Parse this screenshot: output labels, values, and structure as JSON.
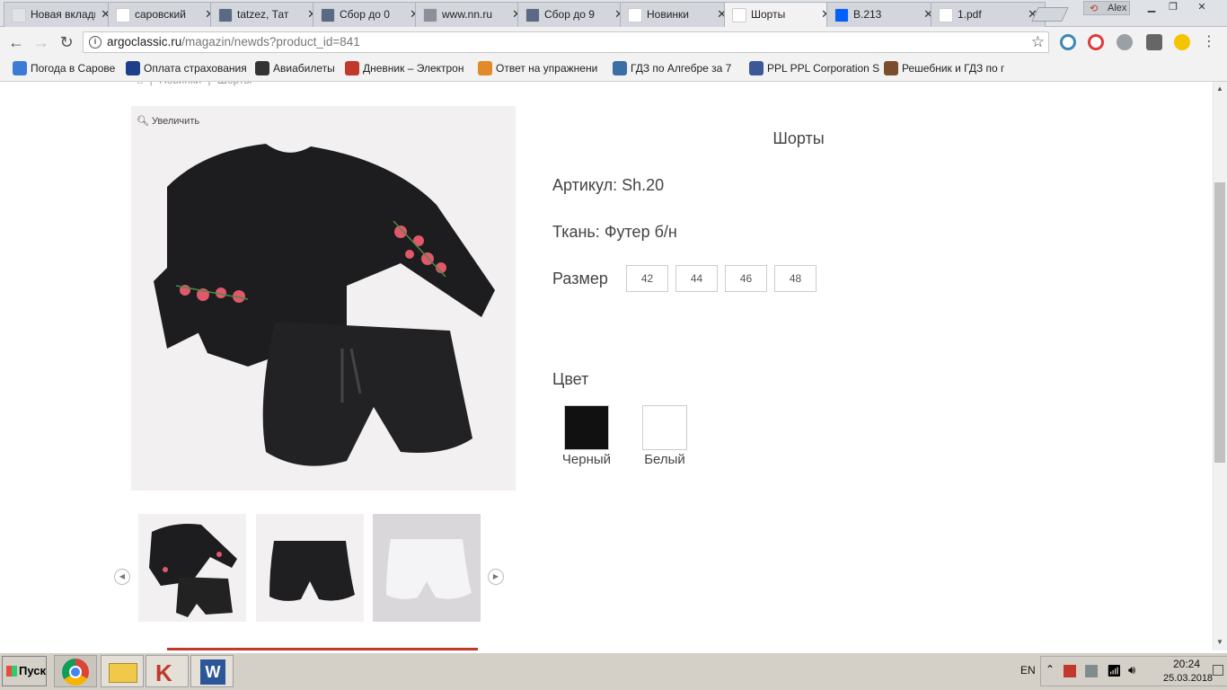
{
  "browser": {
    "tabs": [
      {
        "label": "Новая вкладка",
        "icon": "blank-page-icon",
        "color": "#dfe3e8"
      },
      {
        "label": "саровский",
        "icon": "google-icon",
        "color": "#ffffff"
      },
      {
        "label": "tatzez, Тат",
        "icon": "nn-icon",
        "color": "#5a6a85"
      },
      {
        "label": "Сбор до 0",
        "icon": "nn-icon",
        "color": "#5a6a85"
      },
      {
        "label": "www.nn.ru",
        "icon": "nn-icon",
        "color": "#8a8f99"
      },
      {
        "label": "Сбор до 9",
        "icon": "nn-icon",
        "color": "#5a6a85"
      },
      {
        "label": "Новинки",
        "icon": "gmail-icon",
        "color": "#ffffff"
      },
      {
        "label": "Шорты",
        "icon": "argo-icon",
        "color": "#ffffff",
        "active": true
      },
      {
        "label": "B.213",
        "icon": "dropbox-icon",
        "color": "#0061fe"
      },
      {
        "label": "1.pdf",
        "icon": "document-icon",
        "color": "#ffffff"
      }
    ],
    "profile_name": "Alex",
    "url_host": "argoclassic.ru",
    "url_path": "/magazin/newds?product_id=841",
    "bookmarks": [
      {
        "label": "Погода в Сарове",
        "color": "#3b7bd6"
      },
      {
        "label": "Оплата страхования",
        "color": "#1d3f8a"
      },
      {
        "label": "Авиабилеты",
        "color": "#333333"
      },
      {
        "label": "Дневник – Электрон",
        "color": "#c0392b"
      },
      {
        "label": "Ответ на упражнени",
        "color": "#e08a2a"
      },
      {
        "label": "ГДЗ по Алгебре за 7",
        "color": "#3a6ea5"
      },
      {
        "label": "PPL PPL Corporation S",
        "color": "#3b5998"
      },
      {
        "label": "Решебник и ГДЗ по г",
        "color": "#7a4e2d"
      }
    ]
  },
  "page": {
    "breadcrumb": {
      "home": "⌂",
      "sep1": "|",
      "item1": "Новинки",
      "sep2": "|",
      "item2": "Шорты"
    },
    "zoom_label": "Увеличить",
    "product_title": "Шорты",
    "article_label": "Артикул:",
    "article_value": "Sh.20",
    "fabric_label": "Ткань:",
    "fabric_value": "Футер б/н",
    "size_label": "Размер",
    "sizes": [
      "42",
      "44",
      "46",
      "48"
    ],
    "color_label": "Цвет",
    "colors": [
      {
        "name": "Черный",
        "hex": "#111111"
      },
      {
        "name": "Белый",
        "hex": "#ffffff"
      }
    ],
    "accent_color": "#c0392b"
  },
  "taskbar": {
    "start_label": "Пуск",
    "lang": "EN",
    "time": "20:24",
    "date": "25.03.2018"
  }
}
